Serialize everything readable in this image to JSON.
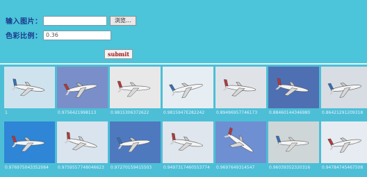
{
  "form": {
    "image_label": "输入图片：",
    "ratio_label": "色彩比例：",
    "file_value": "",
    "browse_label": "浏览...",
    "ratio_value": "0.36",
    "submit_label": "submit"
  },
  "results": [
    {
      "score": "1",
      "sky": "#cfe3ef",
      "icon": "airplane-icon"
    },
    {
      "score": "0.9756421998113",
      "sky": "#7a8fc9",
      "icon": "airplane-icon"
    },
    {
      "score": "0.9815306372622",
      "sky": "#e8e8e8",
      "icon": "airplane-icon"
    },
    {
      "score": "0.9815947E282242",
      "sky": "#e7eef3",
      "icon": "airplane-icon"
    },
    {
      "score": "0.89496957746173",
      "sky": "#dfe3e8",
      "icon": "airplane-icon"
    },
    {
      "score": "0.88460144346980",
      "sky": "#4f6fb3",
      "icon": "airplane-icon"
    },
    {
      "score": "0.86421291209318",
      "sky": "#d7dde3",
      "icon": "airplane-icon"
    },
    {
      "score": "0.976975043352064",
      "sky": "#2f85d6",
      "icon": "airplane-icon"
    },
    {
      "score": "0.9759557748046623",
      "sky": "#d9e4ee",
      "icon": "airplane-icon"
    },
    {
      "score": "0.97270159415503",
      "sky": "#4f79bf",
      "icon": "airplane-icon"
    },
    {
      "score": "0.9497317460553774",
      "sky": "#dfe6ee",
      "icon": "airplane-icon"
    },
    {
      "score": "0.9697649314547",
      "sky": "#6e8fd2",
      "icon": "airplane-icon"
    },
    {
      "score": "0.96039352320316",
      "sky": "#cfd6d8",
      "icon": "airplane-icon"
    },
    {
      "score": "0.94784745467508",
      "sky": "#e6ecf2",
      "icon": "airplane-icon"
    }
  ]
}
